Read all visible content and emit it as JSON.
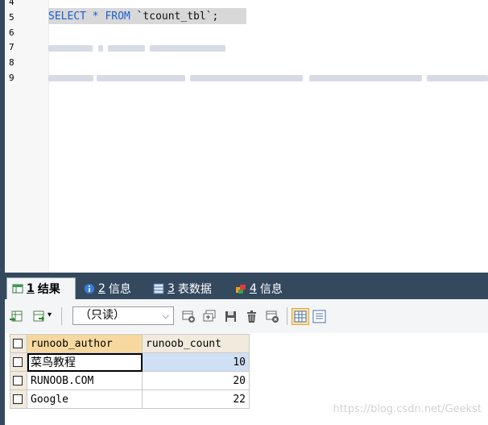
{
  "editor": {
    "line_numbers": [
      "4",
      "5",
      "6",
      "7",
      "8",
      "9"
    ],
    "query": {
      "select_kw": "SELECT",
      "star": " * ",
      "from_kw": "FROM",
      "table": " `tcount_tbl`",
      "semicolon": ";"
    }
  },
  "tabs": [
    {
      "num": "1",
      "label": "结果",
      "icon": "result-grid-icon"
    },
    {
      "num": "2",
      "label": "信息",
      "icon": "info-icon"
    },
    {
      "num": "3",
      "label": "表数据",
      "icon": "table-data-icon"
    },
    {
      "num": "4",
      "label": "信息",
      "icon": "info-icon"
    }
  ],
  "toolbar": {
    "readonly_label": "（只读）",
    "icons": [
      "export-icon",
      "import-icon",
      "dropdown-arrow-icon",
      "add-row-icon",
      "duplicate-row-icon",
      "save-icon",
      "delete-icon",
      "discard-icon",
      "grid-view-icon",
      "text-view-icon"
    ]
  },
  "grid": {
    "columns": [
      "runoob_author",
      "runoob_count"
    ],
    "rows": [
      {
        "author": "菜鸟教程",
        "count": "10"
      },
      {
        "author": "RUNOOB.COM",
        "count": "20"
      },
      {
        "author": "Google",
        "count": "22"
      }
    ]
  },
  "watermark": "https://blog.csdn.net/Geekst",
  "colors": {
    "tab_bar": "#34495e",
    "keyword": "#1a5fd1",
    "header": "#f1eadd",
    "sorted_header": "#f7d9a0",
    "selected_cell": "#cfe0f5"
  }
}
